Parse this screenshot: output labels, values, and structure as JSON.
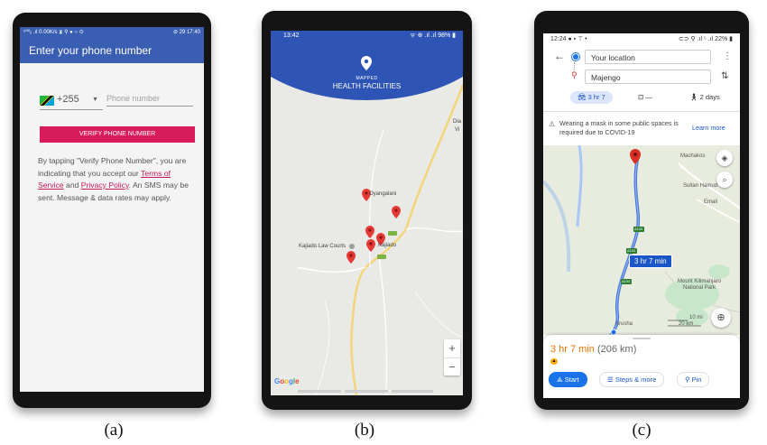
{
  "captions": [
    "(a)",
    "(b)",
    "(c)"
  ],
  "phone_a": {
    "status_left": "⁵⁰⁰ᵢᵢ .ıl 0.00K/s ⧗ ⚲ ● ○ ⊙",
    "status_right": "⊘ 29 17:40",
    "title": "Enter your phone number",
    "country_code": "+255",
    "phone_placeholder": "Phone number",
    "verify_label": "VERIFY PHONE NUMBER",
    "terms_pre": "By tapping \"Verify Phone Number\", you are indicating that you accept our ",
    "terms_link": "Terms of Service",
    "terms_and": " and ",
    "privacy_link": "Privacy Policy",
    "terms_post": ". An SMS may be sent. Message & data rates may apply.",
    "nav": {
      "back": "◁",
      "home": "○",
      "recent": "□"
    }
  },
  "phone_b": {
    "status_time": "13:42",
    "status_right": "ᯤ ⊕ .ıl .ıl 98% ▮",
    "header_small": "MAPPED",
    "header_title": "HEALTH FACILITIES",
    "labels": {
      "oyangalani": "Oyangalani",
      "kajiado": "Kajiado",
      "law_courts": "Kajiado Law Courts",
      "dia": "Dia",
      "vi": "Vi"
    },
    "zoom_in": "+",
    "zoom_out": "−",
    "google": [
      "G",
      "o",
      "o",
      "g",
      "l",
      "e"
    ],
    "google_colors": [
      "#4285f4",
      "#ea4335",
      "#fbbc05",
      "#4285f4",
      "#34a853",
      "#ea4335"
    ],
    "pin_color": "#e53935"
  },
  "phone_c": {
    "status_left": "12:24 ● ▪ ⊤ •",
    "status_right": "⊂⊃ ⚲ .ıl ⁵ .ıl 22% ▮",
    "origin": "Your location",
    "destination": "Majengo",
    "mode_car": "3 hr 7",
    "mode_transit": "—",
    "mode_walk": "2 days",
    "covid_text": "Wearing a mask in some public spaces is required due to COVID-19",
    "learn_more": "Learn more",
    "route_time_badge": "3 hr 7 min",
    "map_labels": {
      "machakos": "Machakos",
      "sultan_hamud": "Sultan Hamud",
      "emali": "Emali",
      "kilimanjaro": "Mount Kilimanjaro National Park",
      "arusha": "Arusha",
      "scale_mi": "10 mi",
      "scale_km": "20 km"
    },
    "road_badges": [
      "A104",
      "A104",
      "A104"
    ],
    "summary_time": "3 hr 7 min",
    "summary_dist": "(206 km)",
    "start": "Start",
    "steps": "Steps & more",
    "pin": "Pin",
    "route_color": "#4a78d8",
    "accent": "#1a73e8"
  }
}
